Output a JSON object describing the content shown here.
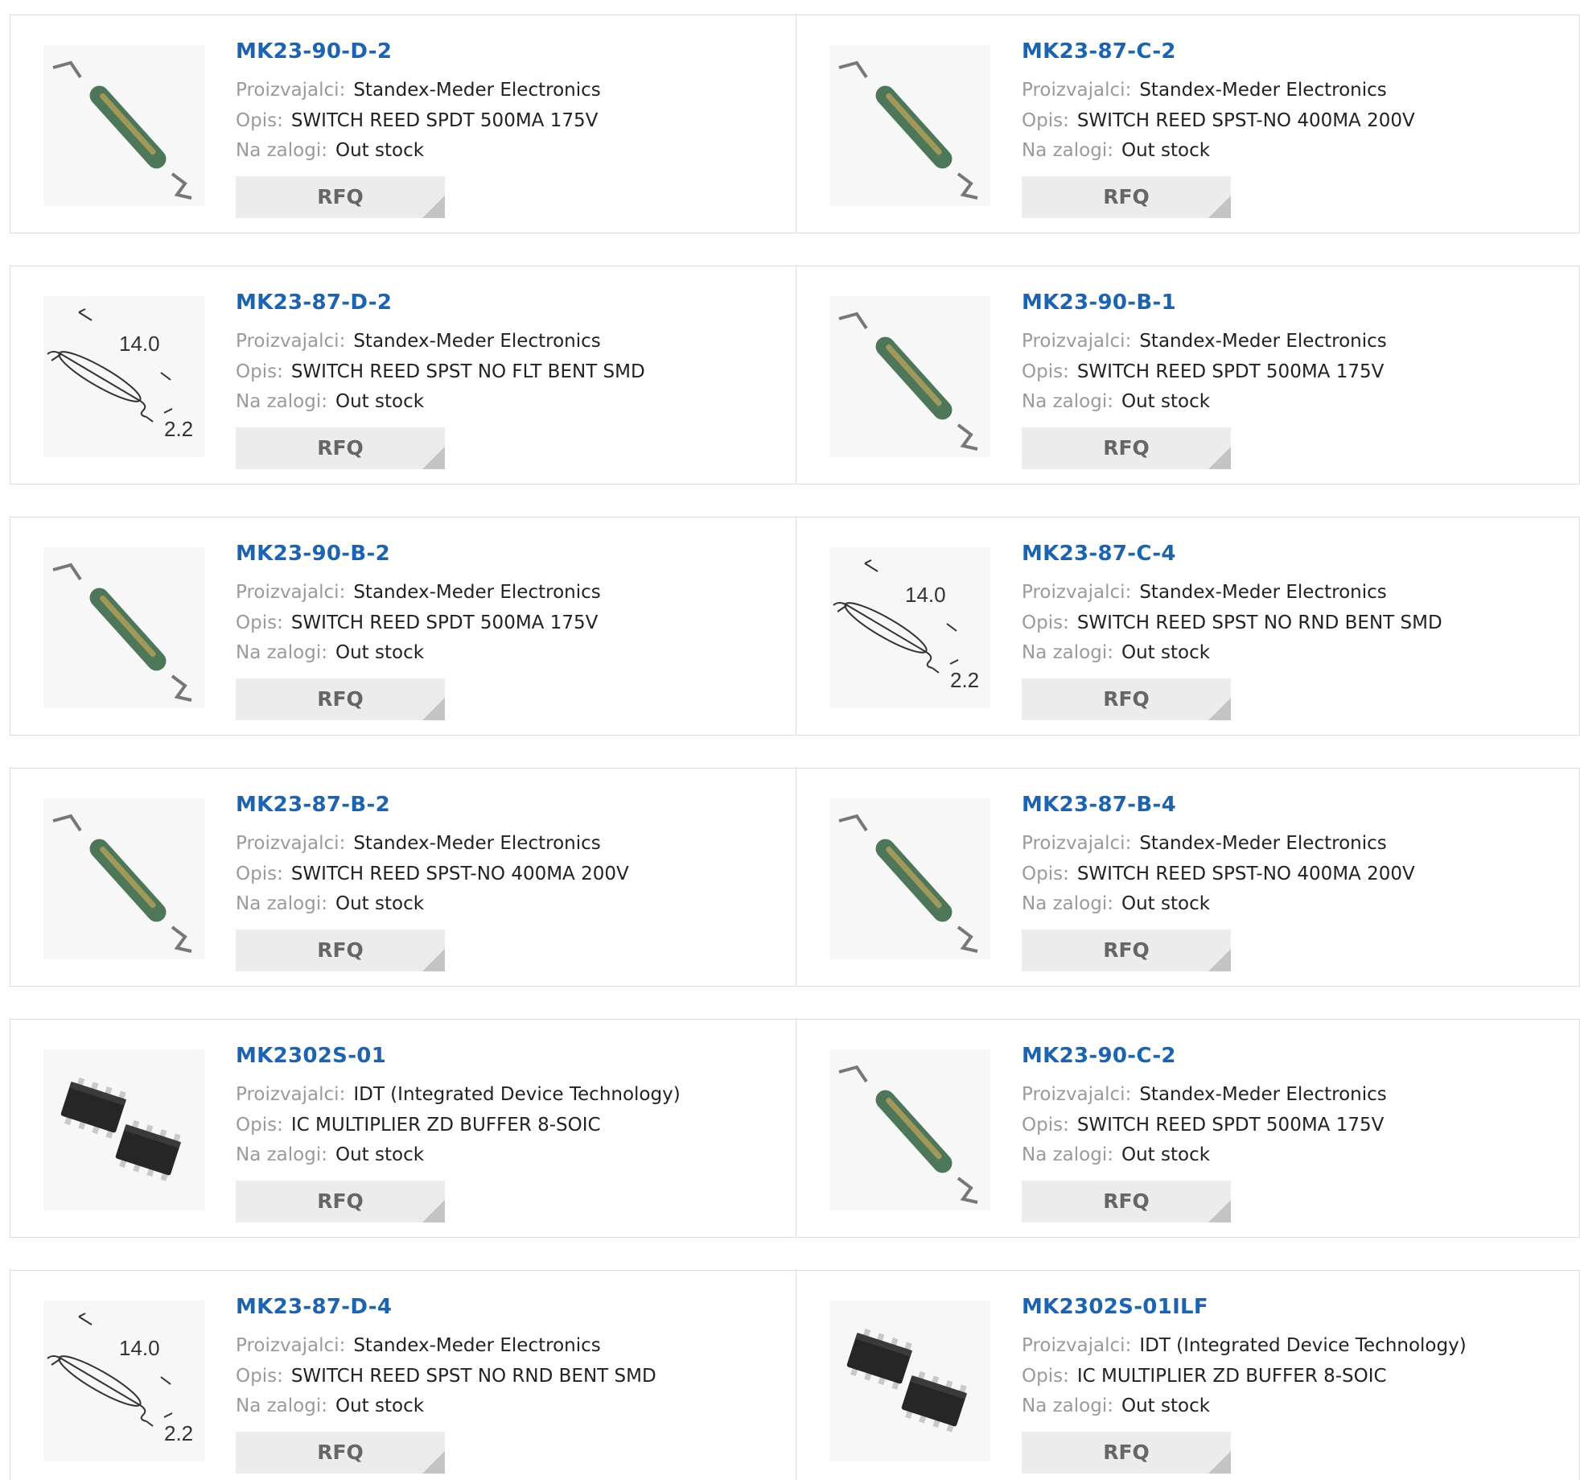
{
  "labels": {
    "manufacturer": "Proizvajalci:",
    "description": "Opis:",
    "stock": "Na zalogi:",
    "rfq": "RFQ"
  },
  "colors": {
    "link": "#1c64b0",
    "label": "#9a9a9a",
    "button_bg": "#ececec",
    "border": "#dcdcdc"
  },
  "products": [
    {
      "pn": "MK23-90-D-2",
      "manufacturer": "Standex-Meder Electronics",
      "description": "SWITCH REED SPDT 500MA 175V",
      "stock": "Out stock",
      "icon": "reed-switch-icon"
    },
    {
      "pn": "MK23-87-C-2",
      "manufacturer": "Standex-Meder Electronics",
      "description": "SWITCH REED SPST-NO 400MA 200V",
      "stock": "Out stock",
      "icon": "reed-switch-icon"
    },
    {
      "pn": "MK23-87-D-2",
      "manufacturer": "Standex-Meder Electronics",
      "description": "SWITCH REED SPST NO FLT BENT SMD",
      "stock": "Out stock",
      "icon": "reed-switch-drawing-icon",
      "dims": [
        "14.0",
        "2.2"
      ]
    },
    {
      "pn": "MK23-90-B-1",
      "manufacturer": "Standex-Meder Electronics",
      "description": "SWITCH REED SPDT 500MA 175V",
      "stock": "Out stock",
      "icon": "reed-switch-icon"
    },
    {
      "pn": "MK23-90-B-2",
      "manufacturer": "Standex-Meder Electronics",
      "description": "SWITCH REED SPDT 500MA 175V",
      "stock": "Out stock",
      "icon": "reed-switch-icon"
    },
    {
      "pn": "MK23-87-C-4",
      "manufacturer": "Standex-Meder Electronics",
      "description": "SWITCH REED SPST NO RND BENT SMD",
      "stock": "Out stock",
      "icon": "reed-switch-drawing-icon",
      "dims": [
        "14.0",
        "2.2"
      ]
    },
    {
      "pn": "MK23-87-B-2",
      "manufacturer": "Standex-Meder Electronics",
      "description": "SWITCH REED SPST-NO 400MA 200V",
      "stock": "Out stock",
      "icon": "reed-switch-icon"
    },
    {
      "pn": "MK23-87-B-4",
      "manufacturer": "Standex-Meder Electronics",
      "description": "SWITCH REED SPST-NO 400MA 200V",
      "stock": "Out stock",
      "icon": "reed-switch-icon"
    },
    {
      "pn": "MK2302S-01",
      "manufacturer": "IDT (Integrated Device Technology)",
      "description": "IC MULTIPLIER ZD BUFFER 8-SOIC",
      "stock": "Out stock",
      "icon": "soic-chip-icon"
    },
    {
      "pn": "MK23-90-C-2",
      "manufacturer": "Standex-Meder Electronics",
      "description": "SWITCH REED SPDT 500MA 175V",
      "stock": "Out stock",
      "icon": "reed-switch-icon"
    },
    {
      "pn": "MK23-87-D-4",
      "manufacturer": "Standex-Meder Electronics",
      "description": "SWITCH REED SPST NO RND BENT SMD",
      "stock": "Out stock",
      "icon": "reed-switch-drawing-icon",
      "dims": [
        "14.0",
        "2.2"
      ]
    },
    {
      "pn": "MK2302S-01ILF",
      "manufacturer": "IDT (Integrated Device Technology)",
      "description": "IC MULTIPLIER ZD BUFFER 8-SOIC",
      "stock": "Out stock",
      "icon": "soic-chip-icon"
    }
  ]
}
